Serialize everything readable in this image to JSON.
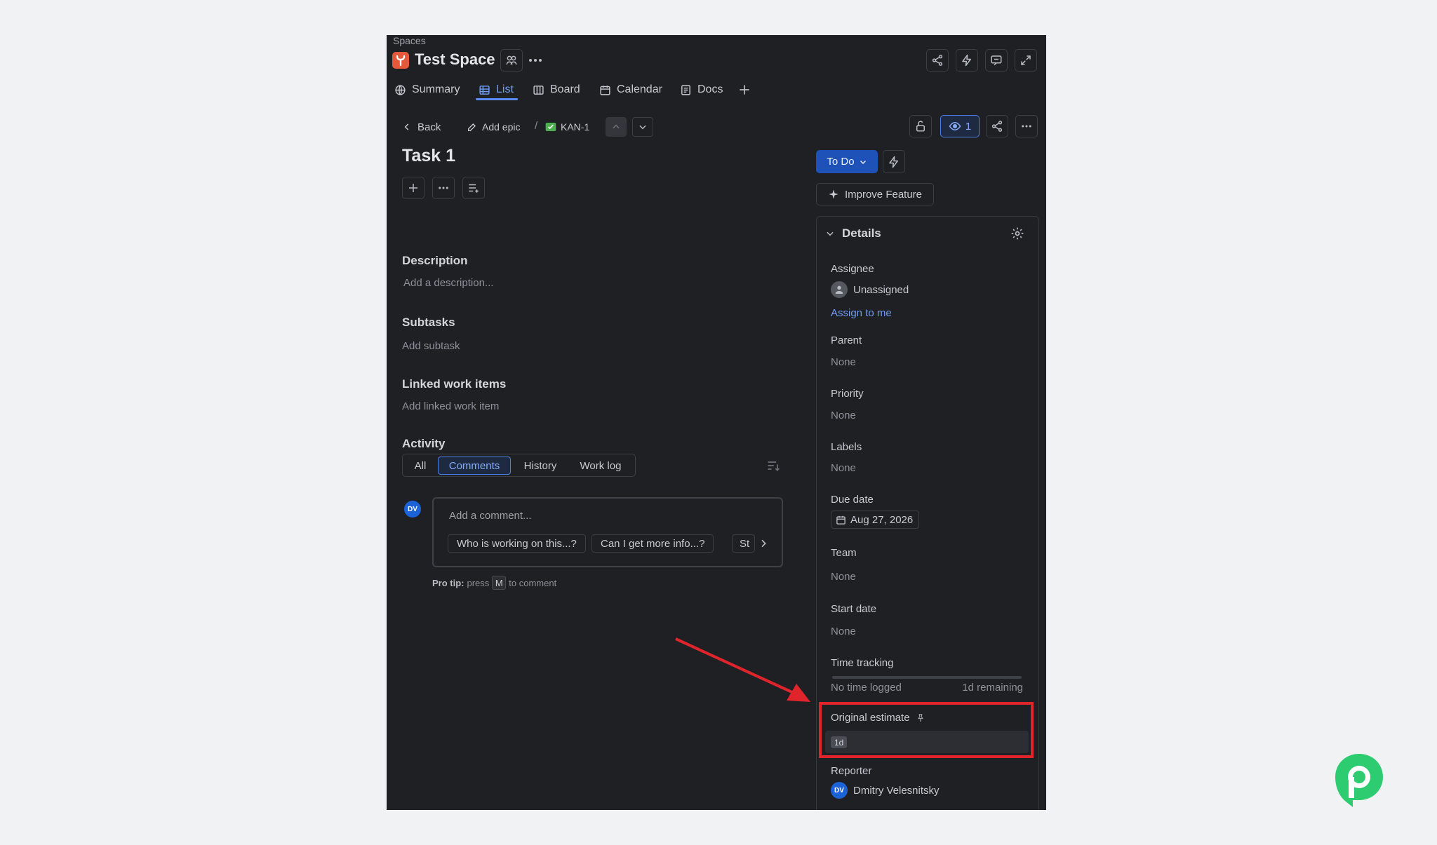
{
  "header": {
    "breadcrumb": "Spaces",
    "space_title": "Test Space"
  },
  "tabs": [
    {
      "label": "Summary",
      "icon": "globe-icon"
    },
    {
      "label": "List",
      "icon": "list-icon",
      "active": true
    },
    {
      "label": "Board",
      "icon": "board-icon"
    },
    {
      "label": "Calendar",
      "icon": "calendar-icon"
    },
    {
      "label": "Docs",
      "icon": "docs-icon"
    }
  ],
  "toolbar": {
    "back_label": "Back",
    "add_epic_label": "Add epic",
    "separator": "/",
    "issue_key": "KAN-1",
    "watch_count": "1"
  },
  "task": {
    "title": "Task 1"
  },
  "sections": {
    "description_title": "Description",
    "description_placeholder": "Add a description...",
    "subtasks_title": "Subtasks",
    "subtasks_add": "Add subtask",
    "linked_title": "Linked work items",
    "linked_add": "Add linked work item",
    "activity_title": "Activity"
  },
  "activity_tabs": [
    {
      "label": "All"
    },
    {
      "label": "Comments",
      "active": true
    },
    {
      "label": "History"
    },
    {
      "label": "Work log"
    }
  ],
  "comment": {
    "avatar_initials": "DV",
    "placeholder": "Add a comment...",
    "suggestions": [
      "Who is working on this...?",
      "Can I get more info...?",
      "St"
    ],
    "pro_tip_label": "Pro tip:",
    "pro_tip_press": "press",
    "pro_tip_key": "M",
    "pro_tip_suffix": "to comment"
  },
  "status": {
    "label": "To Do",
    "improve_label": "Improve Feature"
  },
  "details": {
    "title": "Details",
    "assignee_label": "Assignee",
    "assignee_value": "Unassigned",
    "assign_to_me": "Assign to me",
    "parent_label": "Parent",
    "parent_value": "None",
    "priority_label": "Priority",
    "priority_value": "None",
    "labels_label": "Labels",
    "labels_value": "None",
    "due_date_label": "Due date",
    "due_date_value": "Aug 27, 2026",
    "team_label": "Team",
    "team_value": "None",
    "start_date_label": "Start date",
    "start_date_value": "None",
    "time_tracking_label": "Time tracking",
    "time_logged": "No time logged",
    "time_remaining": "1d remaining",
    "time_logged_fraction": 0,
    "original_estimate_label": "Original estimate",
    "original_estimate_value": "1d",
    "reporter_label": "Reporter",
    "reporter_initials": "DV",
    "reporter_name": "Dmitry Velesnitsky"
  },
  "colors": {
    "accent": "#5a8cf5",
    "status_button": "#1f52b8",
    "highlight": "#e0242c",
    "logo_green": "#2ecc71"
  }
}
